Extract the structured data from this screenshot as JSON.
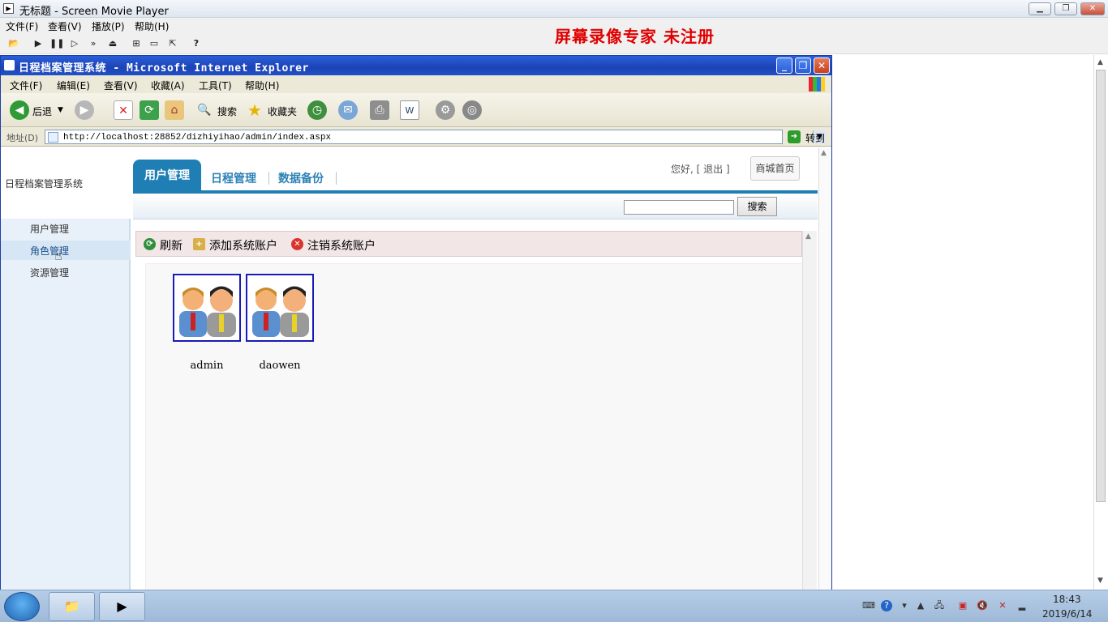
{
  "player": {
    "title": "无标题 - Screen Movie Player",
    "menu": [
      "文件(F)",
      "查看(V)",
      "播放(P)",
      "帮助(H)"
    ],
    "watermark": "屏幕录像专家  未注册"
  },
  "ie": {
    "title": "日程档案管理系统 - Microsoft Internet Explorer",
    "menu": [
      "文件(F)",
      "编辑(E)",
      "查看(V)",
      "收藏(A)",
      "工具(T)",
      "帮助(H)"
    ],
    "toolbar": {
      "back": "后退",
      "search": "搜索",
      "favorites": "收藏夹"
    },
    "address_label": "地址(D)",
    "url": "http://localhost:28852/dizhiyihao/admin/index.aspx",
    "go": "转到"
  },
  "page": {
    "system_name": "日程档案管理系统",
    "tabs": [
      "用户管理",
      "日程管理",
      "数据备份"
    ],
    "greeting": "您好, [ 退出 ]",
    "mall_button": "商城首页",
    "search_button": "搜索",
    "nav": [
      "用户管理",
      "角色管理",
      "资源管理"
    ],
    "actions": [
      "刷新",
      "添加系统账户",
      "注销系统账户"
    ],
    "users": [
      "admin",
      "daowen"
    ]
  },
  "taskbar": {
    "time": "18:43",
    "date": "2019/6/14"
  },
  "colors": {
    "tab_blue": "#1f7fb5",
    "watermark_red": "#e00000",
    "ie_title_blue": "#2150c6"
  }
}
